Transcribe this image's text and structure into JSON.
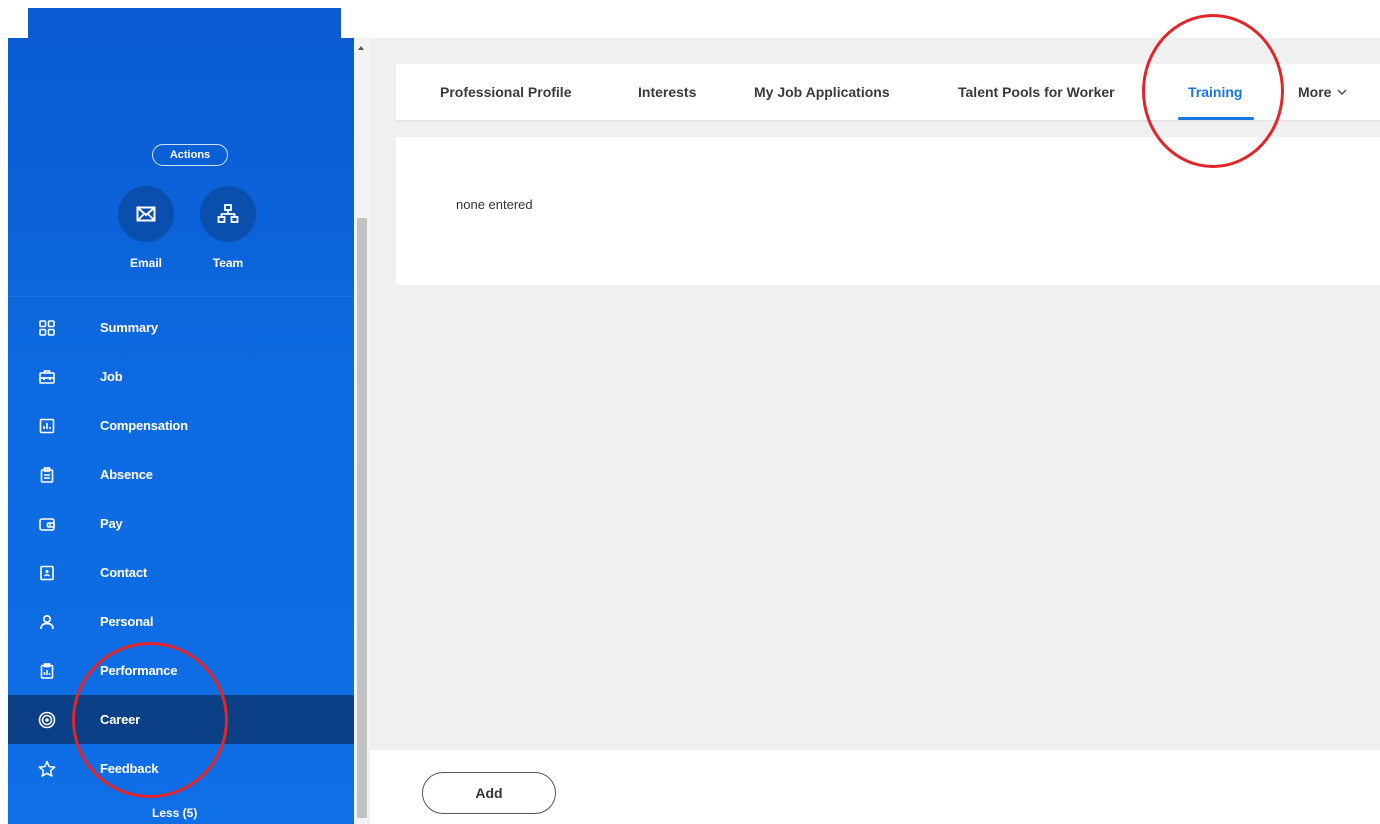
{
  "sidebar": {
    "actions_label": "Actions",
    "quick_actions": [
      {
        "label": "Email",
        "icon": "mail-icon"
      },
      {
        "label": "Team",
        "icon": "org-chart-icon"
      }
    ],
    "nav_items": [
      {
        "label": "Summary",
        "icon": "grid-icon"
      },
      {
        "label": "Job",
        "icon": "briefcase-icon"
      },
      {
        "label": "Compensation",
        "icon": "chart-doc-icon"
      },
      {
        "label": "Absence",
        "icon": "clipboard-icon"
      },
      {
        "label": "Pay",
        "icon": "wallet-icon"
      },
      {
        "label": "Contact",
        "icon": "contact-card-icon"
      },
      {
        "label": "Personal",
        "icon": "person-icon"
      },
      {
        "label": "Performance",
        "icon": "clipboard-chart-icon"
      },
      {
        "label": "Career",
        "icon": "target-icon",
        "active": true
      },
      {
        "label": "Feedback",
        "icon": "star-icon"
      }
    ],
    "less_label": "Less (5)"
  },
  "tabs": [
    {
      "label": "Professional Profile"
    },
    {
      "label": "Interests"
    },
    {
      "label": "My Job Applications"
    },
    {
      "label": "Talent Pools for Worker"
    },
    {
      "label": "Training",
      "active": true
    },
    {
      "label": "More"
    }
  ],
  "panel": {
    "empty_text": "none entered"
  },
  "footer": {
    "add_label": "Add"
  },
  "colors": {
    "sidebar_blue": "#0a5bd1",
    "active_nav": "#0b3f86",
    "tab_active": "#1776e0",
    "annotation_red": "#e0262b"
  }
}
